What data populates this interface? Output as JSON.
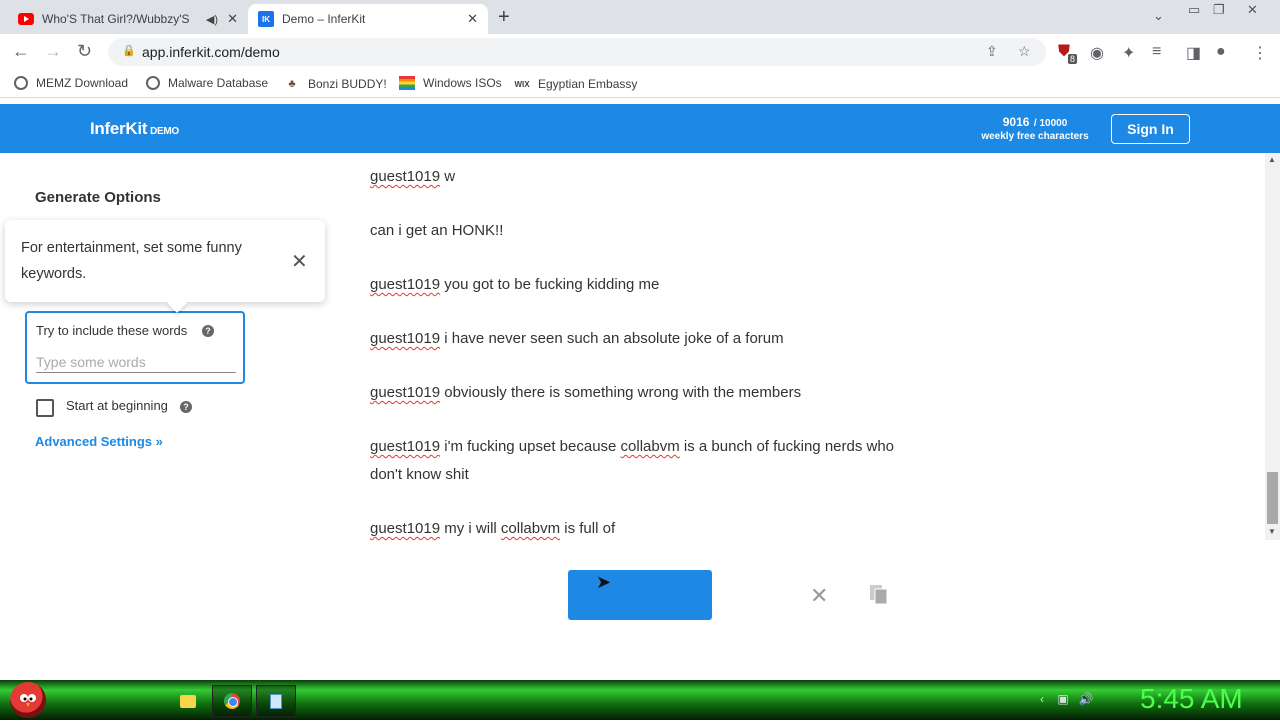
{
  "browser": {
    "tabs": [
      {
        "title": "Who'S That Girl?/Wubbzy'S I",
        "icon": "youtube-icon"
      },
      {
        "title": "Demo – InferKit",
        "icon": "inferkit-icon",
        "favicon_text": "IK"
      }
    ],
    "url": "app.inferkit.com/demo",
    "extension_badge": "8",
    "bookmarks": [
      {
        "label": "MEMZ Download",
        "icon": "globe-icon"
      },
      {
        "label": "Malware Database",
        "icon": "globe-icon"
      },
      {
        "label": "Bonzi BUDDY!",
        "icon": "bonzi-icon"
      },
      {
        "label": "Windows ISOs",
        "icon": "rainbow-flag-icon"
      },
      {
        "label": "Egyptian Embassy",
        "icon": "wix-icon",
        "icon_text": "WIX"
      }
    ]
  },
  "app": {
    "brand": "InferKit",
    "brand_tag": "DEMO",
    "quota_used": "9016",
    "quota_total": "/ 10000",
    "quota_caption": "weekly free characters",
    "signin_label": "Sign In",
    "accent": "#1e88e5"
  },
  "options": {
    "title": "Generate Options",
    "tooltip": "For entertainment, set some funny keywords.",
    "keywords_label": "Try to include these words",
    "keywords_placeholder": "Type some words",
    "keywords_value": "",
    "start_label": "Start at beginning",
    "start_checked": false,
    "advanced_label": "Advanced Settings »"
  },
  "output": {
    "lines": [
      {
        "user": "guest1019",
        "text": " w"
      },
      {
        "user": "",
        "text": "can i get an HONK!!"
      },
      {
        "user": "guest1019",
        "text": " you got to be fucking kidding me"
      },
      {
        "user": "guest1019",
        "text": " i have never seen such an absolute joke of a forum"
      },
      {
        "user": "guest1019",
        "text": " obviously there is something wrong with the members"
      },
      {
        "user": "guest1019",
        "text_parts": [
          " i'm fucking upset because ",
          "collabvm",
          " is a bunch of fucking nerds who don't know shit"
        ]
      },
      {
        "user": "guest1019",
        "text_parts": [
          " my i will ",
          "collabvm",
          " is full of"
        ]
      }
    ]
  },
  "taskbar": {
    "clock": "5:45 AM"
  }
}
